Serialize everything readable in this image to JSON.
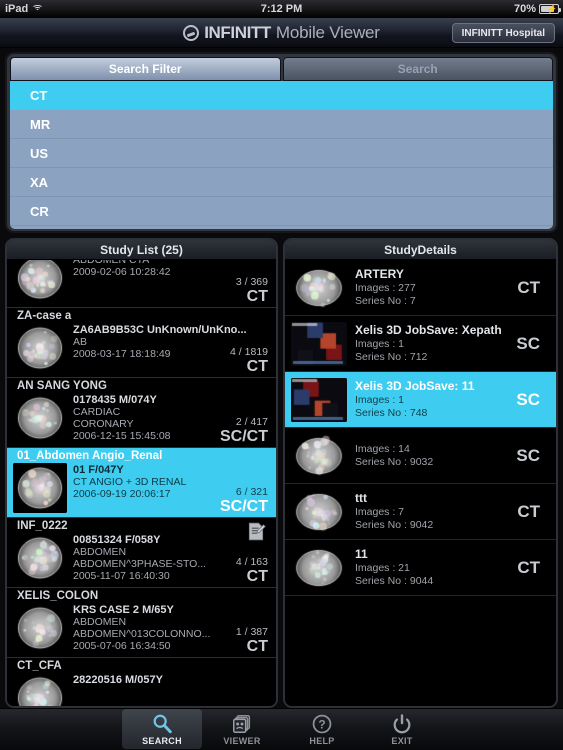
{
  "status_bar": {
    "device": "iPad",
    "wifi_icon": "wifi-icon",
    "time": "7:12 PM",
    "battery_percent": "70%",
    "battery_icon": "battery-charging-icon"
  },
  "header": {
    "logo_icon": "infinitt-logo-icon",
    "title_bold": "INFINITT",
    "title_light": "Mobile Viewer",
    "hospital_button": "INFINITT Hospital"
  },
  "filter": {
    "tabs": [
      {
        "label": "Search Filter",
        "active": true
      },
      {
        "label": "Search",
        "active": false
      }
    ],
    "options": [
      {
        "label": "CT",
        "selected": true
      },
      {
        "label": "MR",
        "selected": false
      },
      {
        "label": "US",
        "selected": false
      },
      {
        "label": "XA",
        "selected": false
      },
      {
        "label": "CR",
        "selected": false
      }
    ],
    "selected_color": "#3ecdf0",
    "row_color": "#8ba3c0"
  },
  "study_list": {
    "title": "Study List (25)",
    "rows": [
      {
        "name": "",
        "patient_id": "",
        "desc1": "ABDOMEN CTA",
        "desc2": "",
        "date": "2009-02-06 10:28:42",
        "count": "3 / 369",
        "modality": "CT",
        "selected": false,
        "clipped": true,
        "has_report": false
      },
      {
        "name": "ZA-case a",
        "patient_id": "ZA6AB9B53C  UnKnown/UnKno...",
        "desc1": "AB",
        "desc2": "",
        "date": "2008-03-17 18:18:49",
        "count": "4 / 1819",
        "modality": "CT",
        "selected": false,
        "clipped": false,
        "has_report": false
      },
      {
        "name": "AN SANG YONG",
        "patient_id": "0178435  M/074Y",
        "desc1": "CARDIAC",
        "desc2": "CORONARY",
        "date": "2006-12-15 15:45:08",
        "count": "2 / 417",
        "modality": "SC/CT",
        "selected": false,
        "clipped": false,
        "has_report": false
      },
      {
        "name": "01_Abdomen Angio_Renal",
        "patient_id": "01  F/047Y",
        "desc1": "",
        "desc2": "CT ANGIO + 3D RENAL",
        "date": "2006-09-19 20:06:17",
        "count": "6 / 321",
        "modality": "SC/CT",
        "selected": true,
        "clipped": false,
        "has_report": false
      },
      {
        "name": "INF_0222",
        "patient_id": "00851324  F/058Y",
        "desc1": "ABDOMEN",
        "desc2": "ABDOMEN^3PHASE-STO...",
        "date": "2005-11-07 16:40:30",
        "count": "4 / 163",
        "modality": "CT",
        "selected": false,
        "clipped": false,
        "has_report": true
      },
      {
        "name": "XELIS_COLON",
        "patient_id": "KRS CASE 2  M/65Y",
        "desc1": "ABDOMEN",
        "desc2": "ABDOMEN^013COLONNO...",
        "date": "2005-07-06 16:34:50",
        "count": "1 / 387",
        "modality": "CT",
        "selected": false,
        "clipped": false,
        "has_report": false
      },
      {
        "name": "CT_CFA",
        "patient_id": "28220516  M/057Y",
        "desc1": "",
        "desc2": "",
        "date": "",
        "count": "",
        "modality": "",
        "selected": false,
        "clipped": false,
        "has_report": false
      }
    ]
  },
  "study_details": {
    "title": "StudyDetails",
    "rows": [
      {
        "title": "ARTERY",
        "images": "Images : 277",
        "series": "Series No : 7",
        "modality": "CT",
        "selected": false
      },
      {
        "title": "Xelis 3D JobSave: Xepath",
        "images": "Images : 1",
        "series": "Series No : 712",
        "modality": "SC",
        "selected": false
      },
      {
        "title": "Xelis 3D JobSave: 11",
        "images": "Images : 1",
        "series": "Series No : 748",
        "modality": "SC",
        "selected": true
      },
      {
        "title": "",
        "images": "Images : 14",
        "series": "Series No : 9032",
        "modality": "SC",
        "selected": false
      },
      {
        "title": "ttt",
        "images": "Images : 7",
        "series": "Series No : 9042",
        "modality": "CT",
        "selected": false
      },
      {
        "title": "11",
        "images": "Images : 21",
        "series": "Series No : 9044",
        "modality": "CT",
        "selected": false
      }
    ]
  },
  "tabbar": {
    "items": [
      {
        "label": "SEARCH",
        "icon": "magnifier-icon",
        "active": true
      },
      {
        "label": "VIEWER",
        "icon": "image-stack-icon",
        "active": false
      },
      {
        "label": "HELP",
        "icon": "question-circle-icon",
        "active": false
      },
      {
        "label": "EXIT",
        "icon": "power-icon",
        "active": false
      }
    ]
  }
}
